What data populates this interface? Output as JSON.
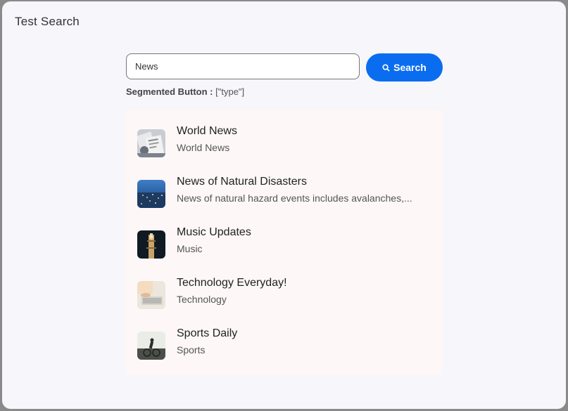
{
  "dialog": {
    "title": "Test Search"
  },
  "search": {
    "value": "News",
    "button_label": "Search"
  },
  "segmented": {
    "label": "Segmented Button :",
    "value": "[\"type\"]"
  },
  "results": [
    {
      "title": "World News",
      "subtitle": "World News",
      "thumb": "newspaper-thumbnail"
    },
    {
      "title": "News of Natural Disasters",
      "subtitle": "News of natural hazard events includes avalanches,...",
      "thumb": "city-night-thumbnail"
    },
    {
      "title": "Music Updates",
      "subtitle": "Music",
      "thumb": "concert-thumbnail"
    },
    {
      "title": "Technology Everyday!",
      "subtitle": "Technology",
      "thumb": "laptop-thumbnail"
    },
    {
      "title": "Sports Daily",
      "subtitle": "Sports",
      "thumb": "cyclist-thumbnail"
    }
  ],
  "colors": {
    "accent": "#0a6df0",
    "dialog_bg": "#f6f6fb",
    "results_bg": "#fdf7f7"
  }
}
